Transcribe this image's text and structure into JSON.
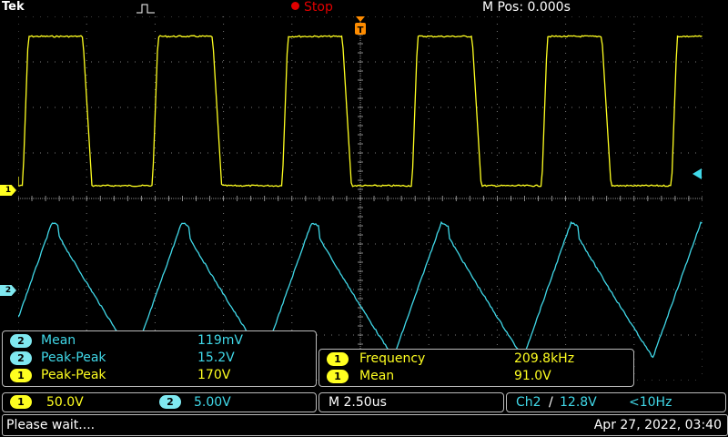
{
  "header": {
    "brand": "Tek",
    "acq_state": "Stop",
    "position": "M Pos: 0.000s"
  },
  "channels": {
    "ch1_marker": "1",
    "ch2_marker": "2"
  },
  "measurements_left": [
    {
      "channel": "2",
      "label": "Mean",
      "value": "119mV"
    },
    {
      "channel": "2",
      "label": "Peak-Peak",
      "value": "15.2V"
    },
    {
      "channel": "1",
      "label": "Peak-Peak",
      "value": "170V"
    }
  ],
  "measurements_right": [
    {
      "channel": "1",
      "label": "Frequency",
      "value": "209.8kHz"
    },
    {
      "channel": "1",
      "label": "Mean",
      "value": "91.0V"
    }
  ],
  "settings": {
    "ch1_num": "1",
    "ch1_scale": "50.0V",
    "ch2_num": "2",
    "ch2_scale": "5.00V",
    "timebase": "M 2.50us",
    "trigger_source": "Ch2",
    "trigger_slope": "/",
    "trigger_level": "12.8V",
    "trigger_freq": "<10Hz"
  },
  "status": {
    "message": "Please wait....",
    "datetime": "Apr 27, 2022, 03:40"
  },
  "colors": {
    "ch1": "#ffff20",
    "ch2": "#40d8e8",
    "stop": "#e00000",
    "trigger_marker": "#ff8c00"
  }
}
